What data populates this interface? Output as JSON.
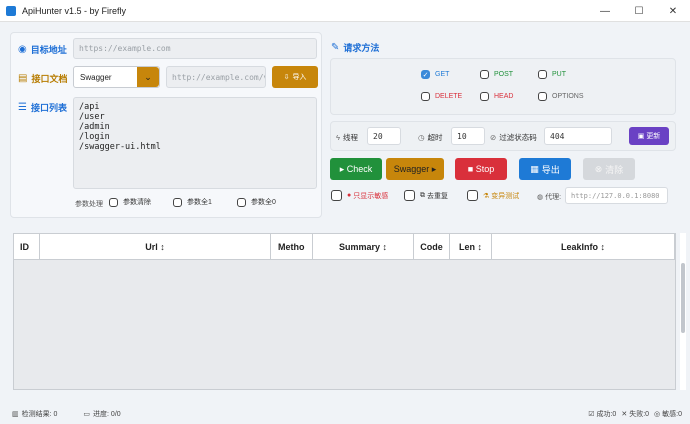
{
  "window": {
    "title": "ApiHunter v1.5 - by Firefly",
    "minimize": "—",
    "maximize": "☐",
    "close": "✕"
  },
  "target": {
    "label": "目标地址",
    "placeholder": "https://example.com"
  },
  "doc": {
    "label": "接口文档",
    "select_value": "Swagger",
    "url_placeholder": "http://example.com/v",
    "import_label": "导入"
  },
  "list": {
    "label": "接口列表",
    "text": "/api\n/user\n/admin\n/login\n/swagger-ui.html"
  },
  "params": {
    "label": "参数处理",
    "options": [
      "参数清除",
      "参数全1",
      "参数全0"
    ]
  },
  "method": {
    "label": "请求方法",
    "options": [
      {
        "label": "GET",
        "checked": true,
        "color": "#1e7ad6"
      },
      {
        "label": "POST",
        "checked": false,
        "color": "#21913b"
      },
      {
        "label": "PUT",
        "checked": false,
        "color": "#21913b"
      },
      {
        "label": "DELETE",
        "checked": false,
        "color": "#d9303b"
      },
      {
        "label": "HEAD",
        "checked": false,
        "color": "#d9303b"
      },
      {
        "label": "OPTIONS",
        "checked": false,
        "color": "#666666"
      }
    ]
  },
  "settings": {
    "thread_label": "线程",
    "thread_value": "20",
    "timeout_label": "超时",
    "timeout_value": "10",
    "filter_label": "过滤状态码",
    "filter_value": "404",
    "update_label": "更新"
  },
  "actions": {
    "check": "▸ Check",
    "swagger": "Swagger ▸",
    "stop": "■ Stop",
    "export": "导出",
    "clear": "清除"
  },
  "options": {
    "sensitive_only": "只显示敏感",
    "dedupe": "去重复",
    "mutate": "变异测试",
    "proxy_label": "代理:",
    "proxy_placeholder": "http://127.0.0.1:8080"
  },
  "table": {
    "columns": [
      "ID",
      "Url ↕",
      "Metho",
      "Summary ↕",
      "Code",
      "Len ↕",
      "LeakInfo ↕"
    ]
  },
  "status": {
    "results": "检测结果: 0",
    "progress": "进度: 0/0",
    "success": "成功:0",
    "fail": "失败:0",
    "sensitive": "敏感:0"
  },
  "icons": {
    "target": "globe-icon",
    "doc": "folder-icon",
    "list": "list-icon",
    "method": "pencil-icon",
    "thread": "bolt-icon",
    "timeout": "clock-icon",
    "filter": "ban-icon",
    "update": "save-icon"
  }
}
